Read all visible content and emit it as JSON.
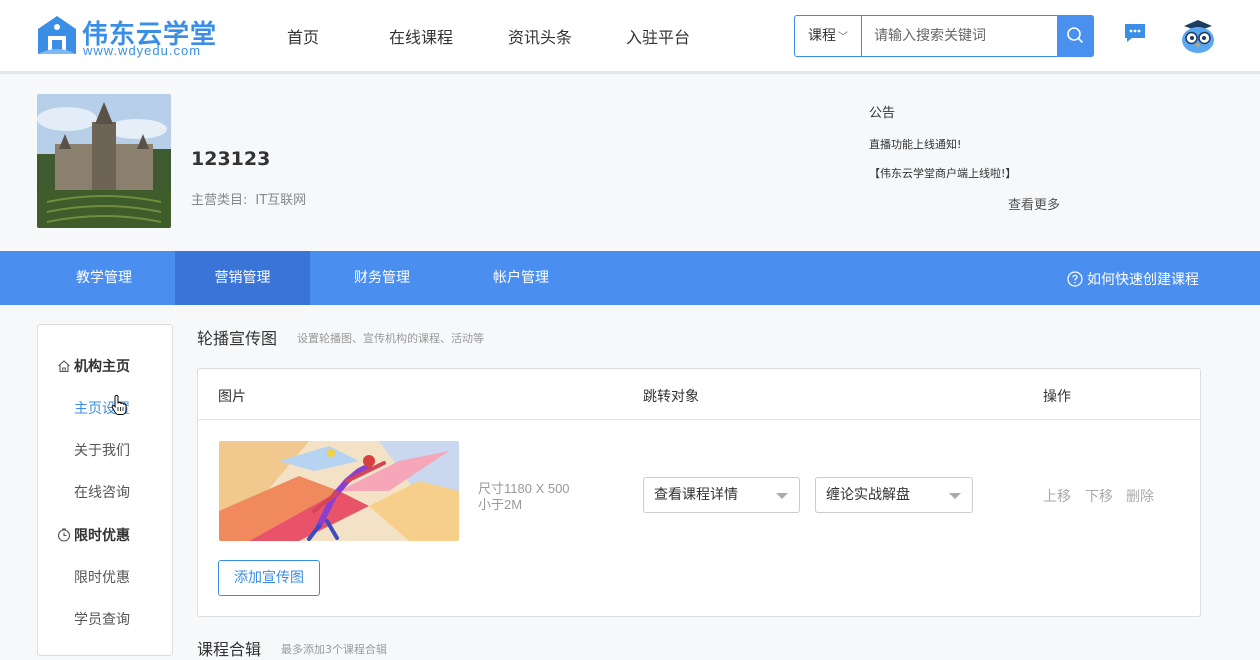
{
  "brand": {
    "name": "伟东云学堂",
    "url": "www.wdyedu.com",
    "color": "#3a8ee6"
  },
  "nav": [
    {
      "label": "首页"
    },
    {
      "label": "在线课程"
    },
    {
      "label": "资讯头条"
    },
    {
      "label": "入驻平台"
    }
  ],
  "search": {
    "category": "课程",
    "placeholder": "请输入搜索关键词",
    "icon": "search-icon"
  },
  "header_icons": {
    "message": "message-icon",
    "avatar": "owl-avatar"
  },
  "shop": {
    "name": "123123",
    "category_label": "主营类目:",
    "category_value": "IT互联网"
  },
  "notice": {
    "title": "公告",
    "items": [
      "直播功能上线通知!",
      "【伟东云学堂商户端上线啦!】"
    ],
    "more": "查看更多"
  },
  "tabs": [
    {
      "label": "教学管理",
      "active": false
    },
    {
      "label": "营销管理",
      "active": true
    },
    {
      "label": "财务管理",
      "active": false
    },
    {
      "label": "帐户管理",
      "active": false
    }
  ],
  "help": {
    "label": "如何快速创建课程",
    "icon": "question-circle-icon"
  },
  "sidebar": {
    "groups": [
      {
        "label": "机构主页",
        "icon": "home-icon",
        "items": [
          "主页设置",
          "关于我们",
          "在线咨询"
        ]
      },
      {
        "label": "限时优惠",
        "icon": "clock-icon",
        "items": [
          "限时优惠",
          "学员查询"
        ]
      }
    ],
    "active_item": "主页设置"
  },
  "carousel": {
    "title": "轮播宣传图",
    "subtitle": "设置轮播图、宣传机构的课程、活动等",
    "columns": [
      "图片",
      "跳转对象",
      "操作"
    ],
    "row": {
      "size_line1": "尺寸1180 X 500",
      "size_line2": "小于2M",
      "link_type": "查看课程详情",
      "link_target": "缠论实战解盘",
      "actions": [
        "上移",
        "下移",
        "删除"
      ]
    },
    "add_button": "添加宣传图"
  },
  "course_album": {
    "title": "课程合辑",
    "subtitle": "最多添加3个课程合辑"
  }
}
